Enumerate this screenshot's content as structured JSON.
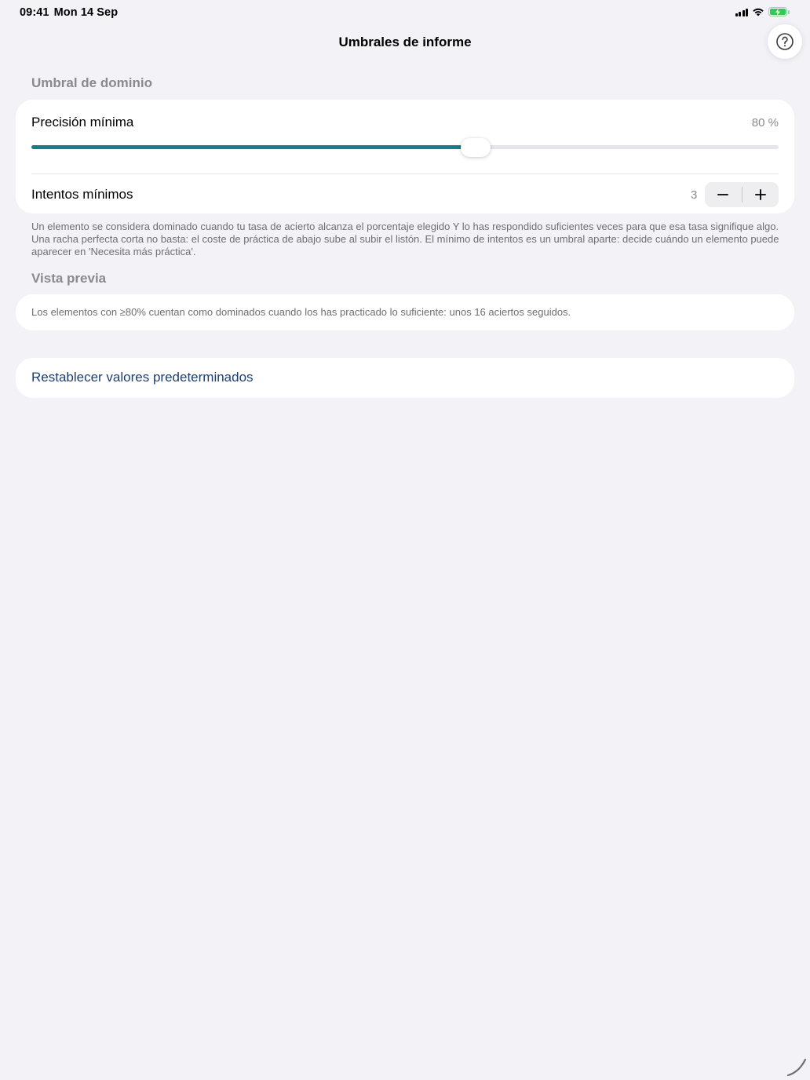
{
  "status_bar": {
    "time": "09:41",
    "date": "Mon 14 Sep"
  },
  "nav": {
    "title": "Umbrales de informe",
    "help_icon": "question-circle-icon"
  },
  "mastery_section": {
    "header": "Umbral de dominio",
    "accuracy": {
      "label": "Precisión mínima",
      "value_text": "80 %",
      "slider_fraction": 0.595
    },
    "attempts": {
      "label": "Intentos mínimos",
      "value": "3",
      "decrement_icon": "minus-icon",
      "increment_icon": "plus-icon"
    },
    "footnote": "Un elemento se considera dominado cuando tu tasa de acierto alcanza el porcentaje elegido Y lo has respondido suficientes veces para que esa tasa signifique algo. Una racha perfecta corta no basta: el coste de práctica de abajo sube al subir el listón. El mínimo de intentos es un umbral aparte: decide cuándo un elemento puede aparecer en 'Necesita más práctica'."
  },
  "preview_section": {
    "header": "Vista previa",
    "text": "Los elementos con ≥80% cuentan como dominados cuando los has practicado lo suficiente: unos 16 aciertos seguidos."
  },
  "reset": {
    "label": "Restablecer valores predeterminados"
  },
  "colors": {
    "accent": "#1c7b82",
    "link": "#1e3f6e",
    "background": "#f2f2f7"
  }
}
